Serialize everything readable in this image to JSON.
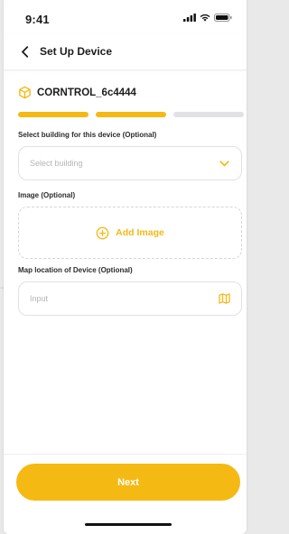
{
  "colors": {
    "accent": "#F5B914",
    "progress_inactive": "#E2E2E4",
    "text_primary": "#1C1C1E",
    "placeholder": "#B5B5B9"
  },
  "status_bar": {
    "time": "9:41",
    "icons": [
      "signal-icon",
      "wifi-icon",
      "battery-icon"
    ]
  },
  "nav": {
    "back_icon": "chevron-left-icon",
    "title": "Set Up Device"
  },
  "device": {
    "icon": "cube-icon",
    "name": "CORNTROL_6c4444"
  },
  "progress": {
    "total_steps": 3,
    "completed_steps": 2
  },
  "form": {
    "building": {
      "label": "Select building for this device (Optional)",
      "placeholder": "Select building",
      "icon": "chevron-down-icon"
    },
    "image": {
      "label": "Image (Optional)",
      "button_label": "Add Image",
      "icon": "plus-circle-icon"
    },
    "map_location": {
      "label": "Map location of Device (Optional)",
      "placeholder": "Input",
      "icon": "map-icon"
    }
  },
  "footer": {
    "next_label": "Next"
  }
}
